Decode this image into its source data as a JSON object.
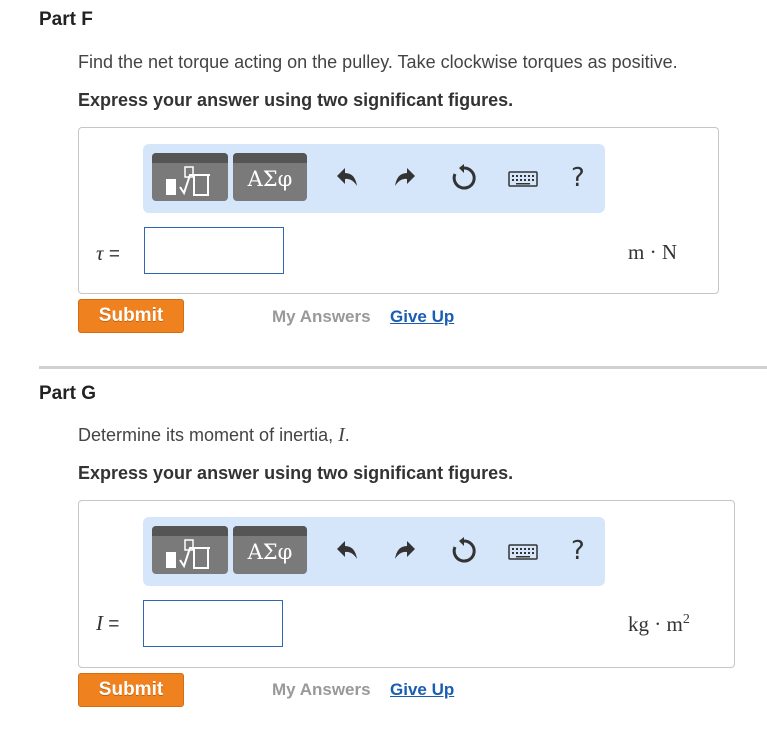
{
  "parts": [
    {
      "title": "Part F",
      "prompt": "Find the net torque acting on the pulley. Take clockwise torques as positive.",
      "instruction": "Express your answer using two significant figures.",
      "toolbar": {
        "greek_label": "ΑΣφ",
        "help_label": "?"
      },
      "variable": "τ",
      "equals": "=",
      "input_value": "",
      "unit": "m · N",
      "unit_sup": "",
      "submit_label": "Submit",
      "my_answers_label": "My Answers",
      "give_up_label": "Give Up"
    },
    {
      "title": "Part G",
      "prompt_prefix": "Determine its moment of inertia, ",
      "prompt_var": "I",
      "prompt_suffix": ".",
      "instruction": "Express your answer using two significant figures.",
      "toolbar": {
        "greek_label": "ΑΣφ",
        "help_label": "?"
      },
      "variable": "I",
      "equals": "=",
      "input_value": "",
      "unit": "kg · m",
      "unit_sup": "2",
      "submit_label": "Submit",
      "my_answers_label": "My Answers",
      "give_up_label": "Give Up"
    }
  ],
  "colors": {
    "toolbar_bg": "#d5e6fb",
    "submit_bg": "#f0811f",
    "link": "#1a5db3",
    "input_border": "#2f68b0"
  }
}
